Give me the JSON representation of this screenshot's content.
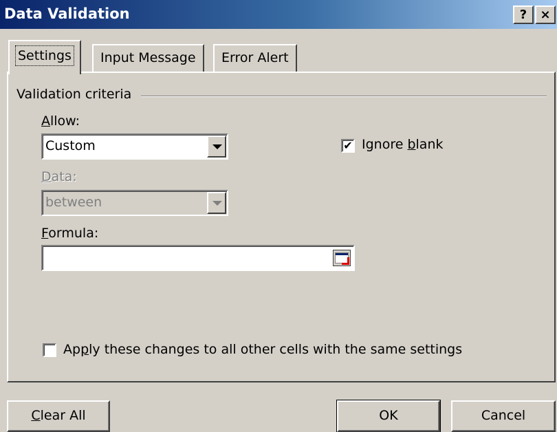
{
  "window": {
    "title": "Data Validation",
    "help_label": "?",
    "close_label": "×"
  },
  "tabs": [
    {
      "label": "Settings",
      "active": true
    },
    {
      "label": "Input Message",
      "active": false
    },
    {
      "label": "Error Alert",
      "active": false
    }
  ],
  "settings": {
    "group_title": "Validation criteria",
    "allow": {
      "label_key": "A",
      "label_rest": "llow:",
      "value": "Custom"
    },
    "ignore_blank": {
      "label_pre": "Ignore ",
      "label_key": "b",
      "label_rest": "lank",
      "checked": true,
      "check_glyph": "✔"
    },
    "data": {
      "label_key": "D",
      "label_rest": "ata:",
      "value": "between",
      "disabled": true
    },
    "formula": {
      "label_key": "F",
      "label_rest": "ormula:",
      "value": ""
    },
    "apply_all": {
      "label_pre": "Ap",
      "label_key": "p",
      "label_rest": "ly these changes to all other cells with the same settings",
      "checked": false
    }
  },
  "buttons": {
    "clear_all": {
      "label_key": "C",
      "label_rest": "lear All"
    },
    "ok": "OK",
    "cancel": "Cancel"
  }
}
